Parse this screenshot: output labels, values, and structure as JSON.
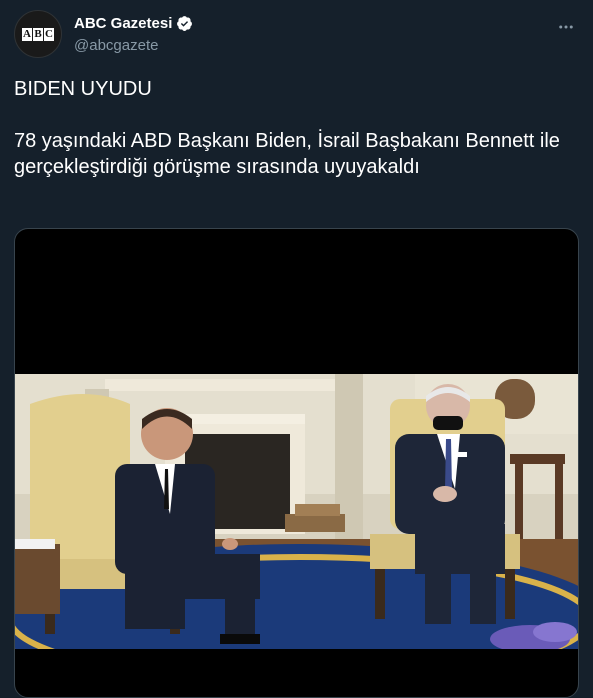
{
  "account": {
    "avatar_letters": [
      "A",
      "B",
      "C"
    ],
    "display_name": "ABC Gazetesi",
    "handle": "@abcgazete",
    "verified": true
  },
  "tweet": {
    "headline": "BIDEN UYUDU",
    "body": "78 yaşındaki ABD Başkanı Biden, İsrail Başbakanı Bennett ile gerçekleştirdiği görüşme sırasında uyuyakaldı"
  },
  "media": {
    "type": "video",
    "description_icon": "video-frame"
  },
  "colors": {
    "background": "#15202b",
    "text": "#ffffff",
    "secondary_text": "#8899a6",
    "verified": "#ffffff",
    "border": "#38444d"
  },
  "icons": [
    "verified-badge-icon",
    "more-options-icon"
  ]
}
